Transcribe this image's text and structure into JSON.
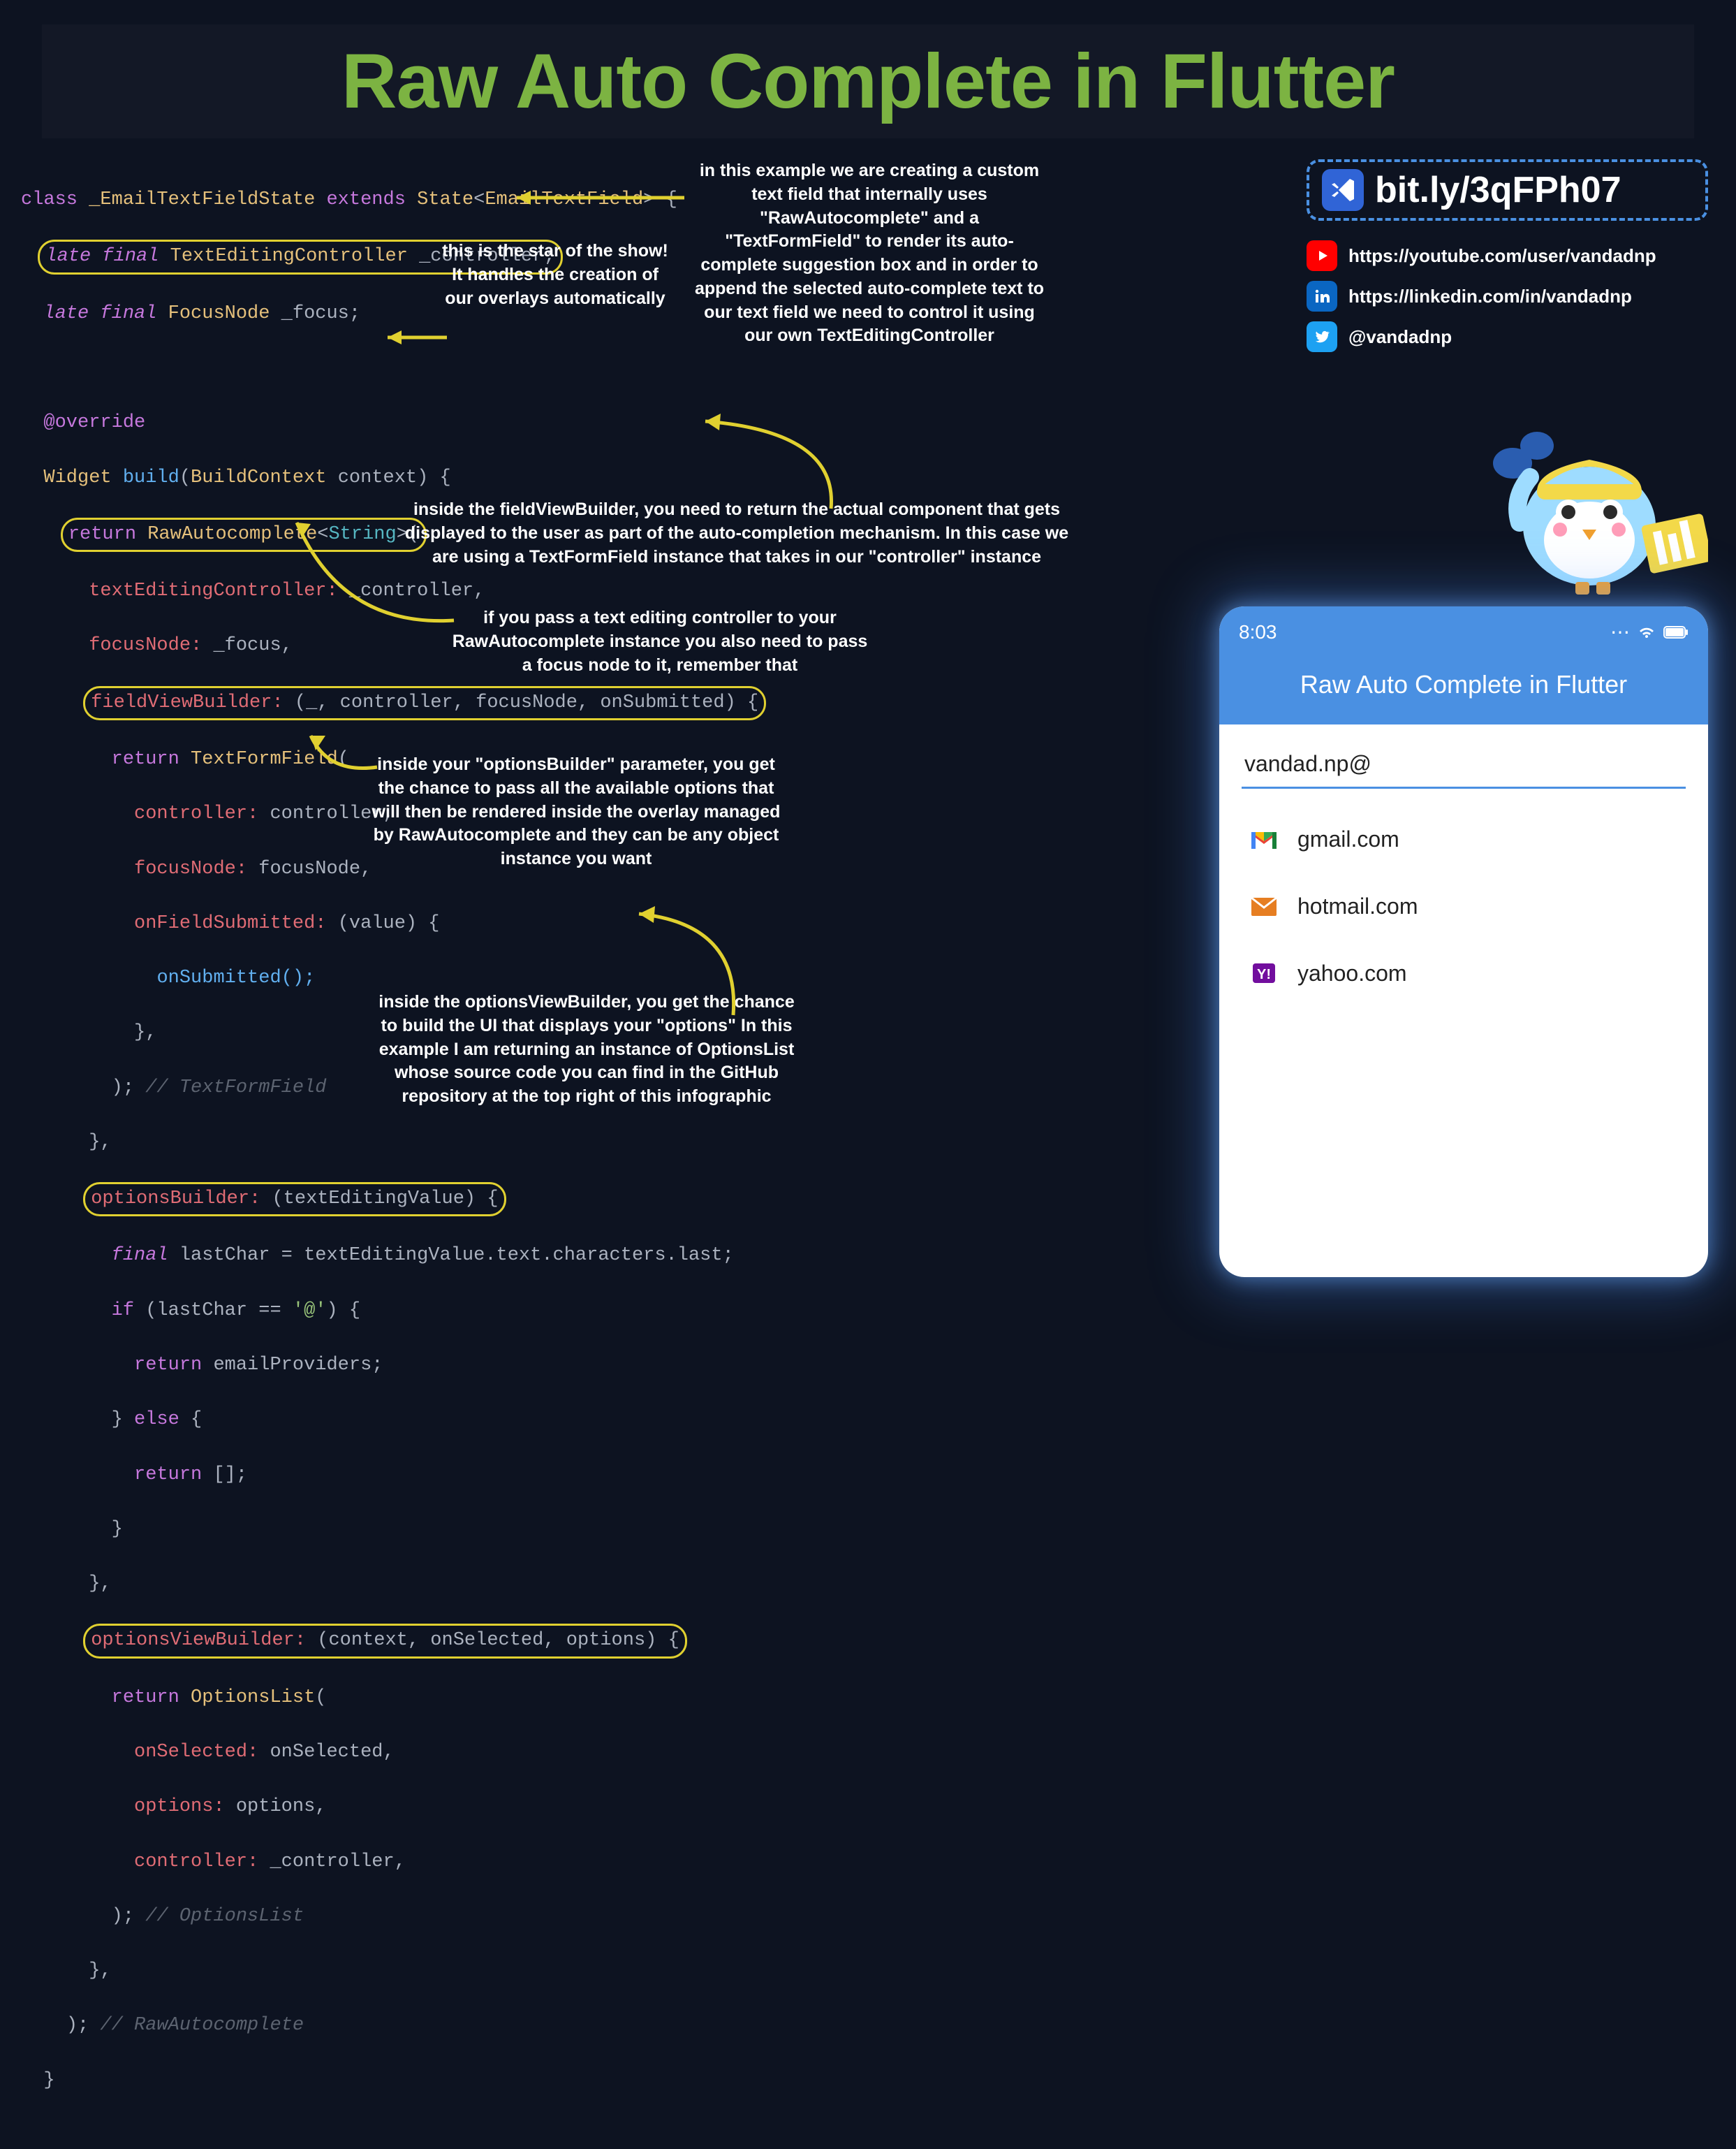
{
  "title": "Raw Auto Complete in Flutter",
  "code": {
    "l1a": "class",
    "l1b": "_EmailTextFieldState",
    "l1c": "extends",
    "l1d": "State",
    "l1e": "EmailTextField",
    "l2a": "late final",
    "l2b": "TextEditingController",
    "l2c": "_controller;",
    "l3a": "late final",
    "l3b": "FocusNode",
    "l3c": "_focus;",
    "l5": "@override",
    "l6a": "Widget",
    "l6b": "build",
    "l6c": "BuildContext",
    "l6d": "context",
    "l7a": "return",
    "l7b": "RawAutocomplete",
    "l7c": "String",
    "l8a": "textEditingController:",
    "l8b": "_controller,",
    "l9a": "focusNode:",
    "l9b": "_focus,",
    "l10a": "fieldViewBuilder:",
    "l10b": "(_, controller, focusNode, onSubmitted) {",
    "l11a": "return",
    "l11b": "TextFormField",
    "l12a": "controller:",
    "l12b": "controller,",
    "l13a": "focusNode:",
    "l13b": "focusNode,",
    "l14a": "onFieldSubmitted:",
    "l14b": "(value) {",
    "l15": "onSubmitted();",
    "l16": "},",
    "l17a": "); ",
    "l17b": "// TextFormField",
    "l18": "},",
    "l19a": "optionsBuilder:",
    "l19b": "(textEditingValue) {",
    "l20a": "final",
    "l20b": "lastChar = textEditingValue.text.characters.last;",
    "l21a": "if",
    "l21b": "(lastChar == ",
    "l21c": "'@'",
    "l21d": ") {",
    "l22a": "return",
    "l22b": "emailProviders;",
    "l23a": "} ",
    "l23b": "else",
    "l23c": " {",
    "l24a": "return",
    "l24b": "[];",
    "l25": "}",
    "l26": "},",
    "l27a": "optionsViewBuilder:",
    "l27b": "(context, onSelected, options) {",
    "l28a": "return",
    "l28b": "OptionsList",
    "l29a": "onSelected:",
    "l29b": "onSelected,",
    "l30a": "options:",
    "l30b": "options,",
    "l31a": "controller:",
    "l31b": "_controller,",
    "l32a": "); ",
    "l32b": "// OptionsList",
    "l33": "},",
    "l34a": "); ",
    "l34b": "// RawAutocomplete",
    "l35": "}"
  },
  "annotations": {
    "a1": "in this example we are creating a custom text field that internally uses \"RawAutocomplete\" and a \"TextFormField\" to render its auto-complete suggestion box and in order to append the selected auto-complete text to our text field we need to control it using our own TextEditingController",
    "a2": "this is the star of the show! It handles the creation of our overlays automatically",
    "a3": "inside the fieldViewBuilder, you need to return the actual component that gets displayed to the user as part of the auto-completion mechanism. In this case we are using a TextFormField instance that takes in our \"controller\" instance",
    "a4": "if you pass a text editing controller to your RawAutocomplete instance you also need to pass a focus node to it, remember that",
    "a5": "inside your \"optionsBuilder\" parameter, you get the chance to pass all the available options that will then be rendered inside the overlay managed by RawAutocomplete and they can be any object instance you want",
    "a6": "inside the optionsViewBuilder, you get the chance to build the UI that displays your \"options\" In this example I am returning an instance of OptionsList whose source code you can find in the GitHub repository at the top right of this infographic"
  },
  "links": {
    "bitly": "bit.ly/3qFPh07",
    "youtube": "https://youtube.com/user/vandadnp",
    "linkedin": "https://linkedin.com/in/vandadnp",
    "twitter": "@vandadnp"
  },
  "phone": {
    "time": "8:03",
    "appbar": "Raw Auto Complete in Flutter",
    "input": "vandad.np@",
    "options": [
      {
        "label": "gmail.com"
      },
      {
        "label": "hotmail.com"
      },
      {
        "label": "yahoo.com"
      }
    ]
  }
}
